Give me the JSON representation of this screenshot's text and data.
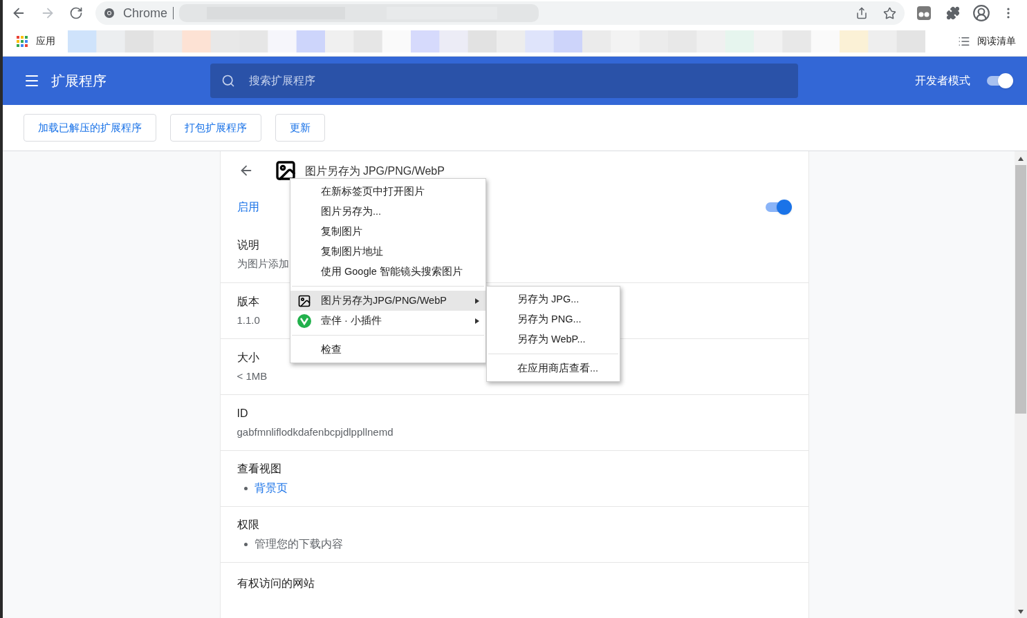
{
  "browser": {
    "address_prefix": "Chrome",
    "bookmark": "应用",
    "reading_list": "阅读清单"
  },
  "header": {
    "title": "扩展程序",
    "search_placeholder": "搜索扩展程序",
    "dev_mode": {
      "label": "开发者模式",
      "on": true
    }
  },
  "toolbar": [
    "加载已解压的扩展程序",
    "打包扩展程序",
    "更新"
  ],
  "detail": {
    "name": "图片另存为 JPG/PNG/WebP",
    "enabled": {
      "label": "启用",
      "on": true
    },
    "sections": [
      {
        "kind": "text",
        "label": "说明",
        "value": "为图片添加"
      },
      {
        "kind": "text",
        "label": "版本",
        "value": "1.1.0"
      },
      {
        "kind": "text",
        "label": "大小",
        "value": "< 1MB"
      },
      {
        "kind": "text",
        "label": "ID",
        "value": "gabfmnliflodkdafenbcpjdlppllnemd"
      },
      {
        "kind": "links",
        "label": "查看视图",
        "items": [
          "背景页"
        ]
      },
      {
        "kind": "list",
        "label": "权限",
        "items": [
          "管理您的下载内容"
        ]
      },
      {
        "kind": "title",
        "label": "有权访问的网站"
      }
    ]
  },
  "context_menu": [
    {
      "kind": "item",
      "label": "在新标签页中打开图片",
      "selected": false
    },
    {
      "kind": "item",
      "label": "图片另存为...",
      "selected": false
    },
    {
      "kind": "item",
      "label": "复制图片",
      "selected": false
    },
    {
      "kind": "item",
      "label": "复制图片地址",
      "selected": false
    },
    {
      "kind": "item",
      "label": "使用 Google 智能镜头搜索图片",
      "selected": false
    },
    {
      "kind": "separator"
    },
    {
      "kind": "submenu",
      "label": "图片另存为JPG/PNG/WebP",
      "selected": true
    },
    {
      "kind": "submenu",
      "label": "壹伴 · 小插件",
      "selected": false
    },
    {
      "kind": "separator"
    },
    {
      "kind": "item",
      "label": "检查",
      "selected": false
    }
  ],
  "submenu": [
    {
      "kind": "item",
      "label": "另存为 JPG...",
      "selected": false
    },
    {
      "kind": "item",
      "label": "另存为 PNG...",
      "selected": false
    },
    {
      "kind": "item",
      "label": "另存为 WebP...",
      "selected": false
    },
    {
      "kind": "separator"
    },
    {
      "kind": "item",
      "label": "在应用商店查看...",
      "selected": false
    }
  ]
}
